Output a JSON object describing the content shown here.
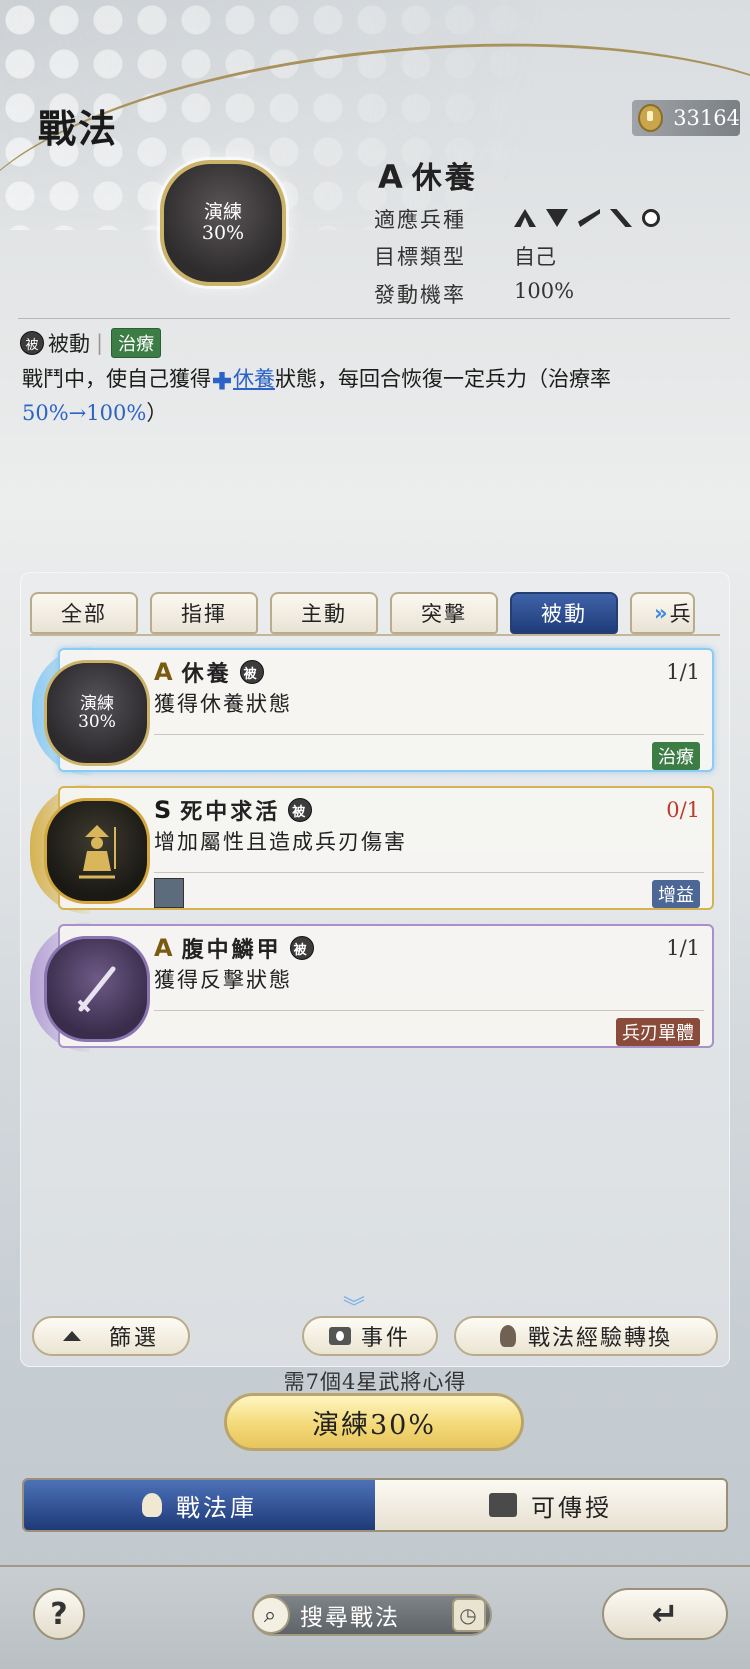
{
  "page": {
    "title": "戰法"
  },
  "currency": {
    "amount": "33164",
    "icon": "seal-coin-icon"
  },
  "skill": {
    "emblem_line1": "演練",
    "emblem_line2": "30%",
    "grade": "A",
    "name": "休養",
    "troop_label": "適應兵種",
    "troop_icons": [
      "cavalry-icon",
      "archer-icon",
      "spear-icon",
      "shield-icon",
      "siege-icon"
    ],
    "target_label": "目標類型",
    "target_value": "自己",
    "rate_label": "發動機率",
    "rate_value": "100%",
    "type_badge": "被",
    "type_text": "被動",
    "category_tag": "治療",
    "desc_part1": "戰鬥中，使自己獲得",
    "desc_link": "休養",
    "desc_part2": "狀態，每回合恢復一定兵力（治療率",
    "desc_rate": "50%→100%",
    "desc_end": "）"
  },
  "tabs": [
    {
      "label": "全部",
      "active": false
    },
    {
      "label": "指揮",
      "active": false
    },
    {
      "label": "主動",
      "active": false
    },
    {
      "label": "突擊",
      "active": false
    },
    {
      "label": "被動",
      "active": true
    },
    {
      "label": "兵",
      "active": false
    }
  ],
  "cards": [
    {
      "grade": "A",
      "name": "休養",
      "badge": "被",
      "sub": "獲得休養狀態",
      "count": "1/1",
      "tag": "治療",
      "emblem_line1": "演練",
      "emblem_line2": "30%"
    },
    {
      "grade": "S",
      "name": "死中求活",
      "badge": "被",
      "sub": "增加屬性且造成兵刃傷害",
      "count": "0/1",
      "tag": "增益"
    },
    {
      "grade": "A",
      "name": "腹中鱗甲",
      "badge": "被",
      "sub": "獲得反擊狀態",
      "count": "1/1",
      "tag": "兵刃單體"
    }
  ],
  "controls": {
    "filter_label": "篩選",
    "event_label": "事件",
    "convert_label": "戰法經驗轉換",
    "need_text": "需7個4星武將心得",
    "train_label": "演練30%"
  },
  "segments": {
    "library": "戰法庫",
    "transferable": "可傳授"
  },
  "bottom": {
    "search_placeholder": "搜尋戰法",
    "help": "?"
  },
  "colors": {
    "accent_blue": "#2b63c9",
    "tag_green": "#3b7d45",
    "gold": "#d6b34f"
  }
}
